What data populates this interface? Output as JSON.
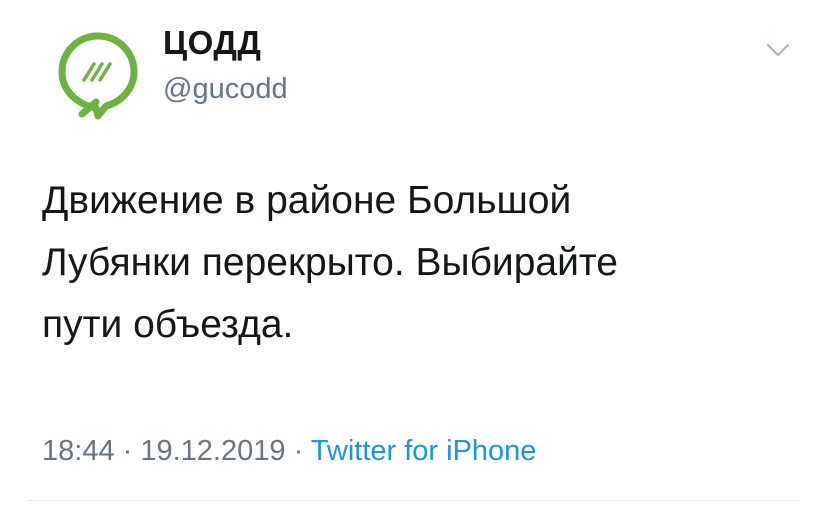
{
  "author": {
    "name": "ЦОДД",
    "handle": "@gucodd",
    "avatar_icon": "codd-logo-icon",
    "brand_color": "#6cb33f"
  },
  "tweet": {
    "lines": [
      "Движение в районе Большой",
      "Лубянки перекрыто. Выбирайте",
      "пути объезда."
    ],
    "time": "18:44",
    "separator": " · ",
    "date": "19.12.2019",
    "source": "Twitter for iPhone",
    "link_color": "#1b95e0"
  },
  "menu": {
    "icon": "chevron-down-icon"
  }
}
